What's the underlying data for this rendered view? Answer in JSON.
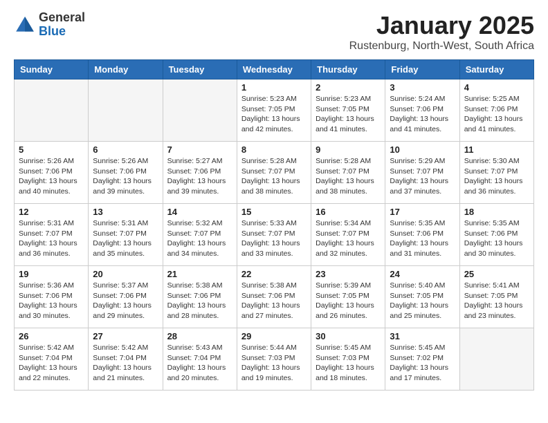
{
  "logo": {
    "general": "General",
    "blue": "Blue"
  },
  "title": "January 2025",
  "location": "Rustenburg, North-West, South Africa",
  "days_of_week": [
    "Sunday",
    "Monday",
    "Tuesday",
    "Wednesday",
    "Thursday",
    "Friday",
    "Saturday"
  ],
  "weeks": [
    [
      {
        "day": "",
        "info": ""
      },
      {
        "day": "",
        "info": ""
      },
      {
        "day": "",
        "info": ""
      },
      {
        "day": "1",
        "info": "Sunrise: 5:23 AM\nSunset: 7:05 PM\nDaylight: 13 hours and 42 minutes."
      },
      {
        "day": "2",
        "info": "Sunrise: 5:23 AM\nSunset: 7:05 PM\nDaylight: 13 hours and 41 minutes."
      },
      {
        "day": "3",
        "info": "Sunrise: 5:24 AM\nSunset: 7:06 PM\nDaylight: 13 hours and 41 minutes."
      },
      {
        "day": "4",
        "info": "Sunrise: 5:25 AM\nSunset: 7:06 PM\nDaylight: 13 hours and 41 minutes."
      }
    ],
    [
      {
        "day": "5",
        "info": "Sunrise: 5:26 AM\nSunset: 7:06 PM\nDaylight: 13 hours and 40 minutes."
      },
      {
        "day": "6",
        "info": "Sunrise: 5:26 AM\nSunset: 7:06 PM\nDaylight: 13 hours and 39 minutes."
      },
      {
        "day": "7",
        "info": "Sunrise: 5:27 AM\nSunset: 7:06 PM\nDaylight: 13 hours and 39 minutes."
      },
      {
        "day": "8",
        "info": "Sunrise: 5:28 AM\nSunset: 7:07 PM\nDaylight: 13 hours and 38 minutes."
      },
      {
        "day": "9",
        "info": "Sunrise: 5:28 AM\nSunset: 7:07 PM\nDaylight: 13 hours and 38 minutes."
      },
      {
        "day": "10",
        "info": "Sunrise: 5:29 AM\nSunset: 7:07 PM\nDaylight: 13 hours and 37 minutes."
      },
      {
        "day": "11",
        "info": "Sunrise: 5:30 AM\nSunset: 7:07 PM\nDaylight: 13 hours and 36 minutes."
      }
    ],
    [
      {
        "day": "12",
        "info": "Sunrise: 5:31 AM\nSunset: 7:07 PM\nDaylight: 13 hours and 36 minutes."
      },
      {
        "day": "13",
        "info": "Sunrise: 5:31 AM\nSunset: 7:07 PM\nDaylight: 13 hours and 35 minutes."
      },
      {
        "day": "14",
        "info": "Sunrise: 5:32 AM\nSunset: 7:07 PM\nDaylight: 13 hours and 34 minutes."
      },
      {
        "day": "15",
        "info": "Sunrise: 5:33 AM\nSunset: 7:07 PM\nDaylight: 13 hours and 33 minutes."
      },
      {
        "day": "16",
        "info": "Sunrise: 5:34 AM\nSunset: 7:07 PM\nDaylight: 13 hours and 32 minutes."
      },
      {
        "day": "17",
        "info": "Sunrise: 5:35 AM\nSunset: 7:06 PM\nDaylight: 13 hours and 31 minutes."
      },
      {
        "day": "18",
        "info": "Sunrise: 5:35 AM\nSunset: 7:06 PM\nDaylight: 13 hours and 30 minutes."
      }
    ],
    [
      {
        "day": "19",
        "info": "Sunrise: 5:36 AM\nSunset: 7:06 PM\nDaylight: 13 hours and 30 minutes."
      },
      {
        "day": "20",
        "info": "Sunrise: 5:37 AM\nSunset: 7:06 PM\nDaylight: 13 hours and 29 minutes."
      },
      {
        "day": "21",
        "info": "Sunrise: 5:38 AM\nSunset: 7:06 PM\nDaylight: 13 hours and 28 minutes."
      },
      {
        "day": "22",
        "info": "Sunrise: 5:38 AM\nSunset: 7:06 PM\nDaylight: 13 hours and 27 minutes."
      },
      {
        "day": "23",
        "info": "Sunrise: 5:39 AM\nSunset: 7:05 PM\nDaylight: 13 hours and 26 minutes."
      },
      {
        "day": "24",
        "info": "Sunrise: 5:40 AM\nSunset: 7:05 PM\nDaylight: 13 hours and 25 minutes."
      },
      {
        "day": "25",
        "info": "Sunrise: 5:41 AM\nSunset: 7:05 PM\nDaylight: 13 hours and 23 minutes."
      }
    ],
    [
      {
        "day": "26",
        "info": "Sunrise: 5:42 AM\nSunset: 7:04 PM\nDaylight: 13 hours and 22 minutes."
      },
      {
        "day": "27",
        "info": "Sunrise: 5:42 AM\nSunset: 7:04 PM\nDaylight: 13 hours and 21 minutes."
      },
      {
        "day": "28",
        "info": "Sunrise: 5:43 AM\nSunset: 7:04 PM\nDaylight: 13 hours and 20 minutes."
      },
      {
        "day": "29",
        "info": "Sunrise: 5:44 AM\nSunset: 7:03 PM\nDaylight: 13 hours and 19 minutes."
      },
      {
        "day": "30",
        "info": "Sunrise: 5:45 AM\nSunset: 7:03 PM\nDaylight: 13 hours and 18 minutes."
      },
      {
        "day": "31",
        "info": "Sunrise: 5:45 AM\nSunset: 7:02 PM\nDaylight: 13 hours and 17 minutes."
      },
      {
        "day": "",
        "info": ""
      }
    ]
  ]
}
